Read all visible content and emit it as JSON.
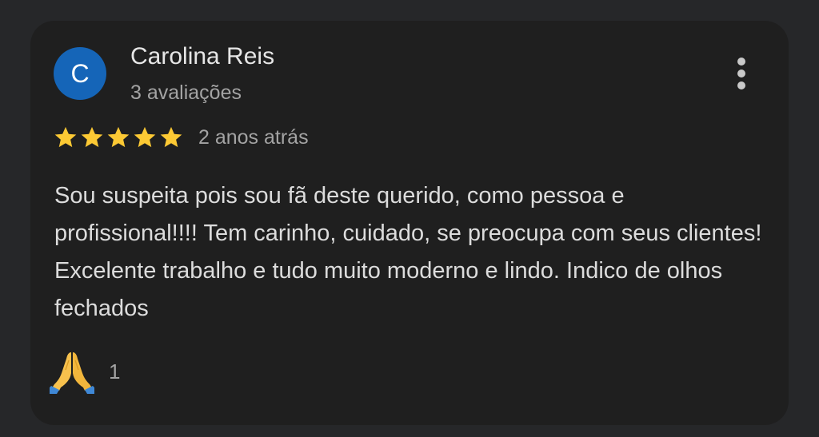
{
  "review": {
    "author": {
      "initial": "C",
      "name": "Carolina Reis",
      "reviews_count": "3 avaliações",
      "avatar_color": "#1565b8"
    },
    "rating": 5,
    "max_rating": 5,
    "star_color": "#fcc934",
    "time_ago": "2 anos atrás",
    "text": "Sou suspeita pois sou fã deste querido, como pessoa e profissional!!!! Tem carinho, cuidado, se preocupa com seus clientes! Excelente trabalho e tudo muito moderno e lindo. Indico de olhos fechados",
    "reaction": {
      "icon": "folded-hands-icon",
      "count": "1"
    },
    "menu_icon": "more-vert-icon"
  }
}
